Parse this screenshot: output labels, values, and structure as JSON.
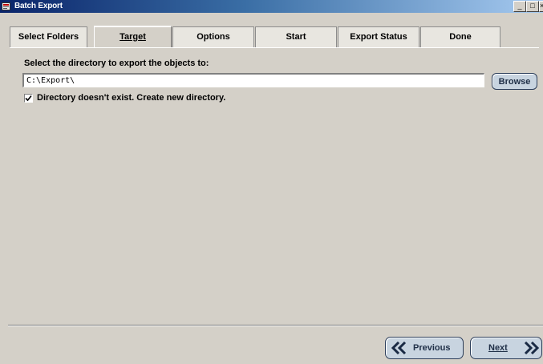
{
  "window": {
    "title": "Batch Export",
    "controls": {
      "minimize": "_",
      "maximize": "□",
      "close": "×"
    }
  },
  "tabs": [
    {
      "label": "Select Folders",
      "active": false
    },
    {
      "label": "Target",
      "active": true
    },
    {
      "label": "Options",
      "active": false
    },
    {
      "label": "Start",
      "active": false
    },
    {
      "label": "Export Status",
      "active": false
    },
    {
      "label": "Done",
      "active": false
    }
  ],
  "target": {
    "prompt": "Select the directory to export the objects to:",
    "directory_value": "C:\\Export\\",
    "browse_label": "Browse",
    "create_dir_checked": true,
    "create_dir_label": "Directory doesn't exist. Create new directory."
  },
  "navigation": {
    "previous_label": "Previous",
    "next_label": "Next"
  },
  "icons": {
    "app": "export-app-icon",
    "checkmark": "checkmark-icon",
    "previous": "double-chevron-left-icon",
    "next": "double-chevron-right-icon"
  },
  "colors": {
    "title_bar_start": "#0a246a",
    "title_bar_end": "#a6caf0",
    "window_face": "#d4d0c8",
    "button_face": "#c8d4e0",
    "button_border": "#2c3e5a"
  }
}
